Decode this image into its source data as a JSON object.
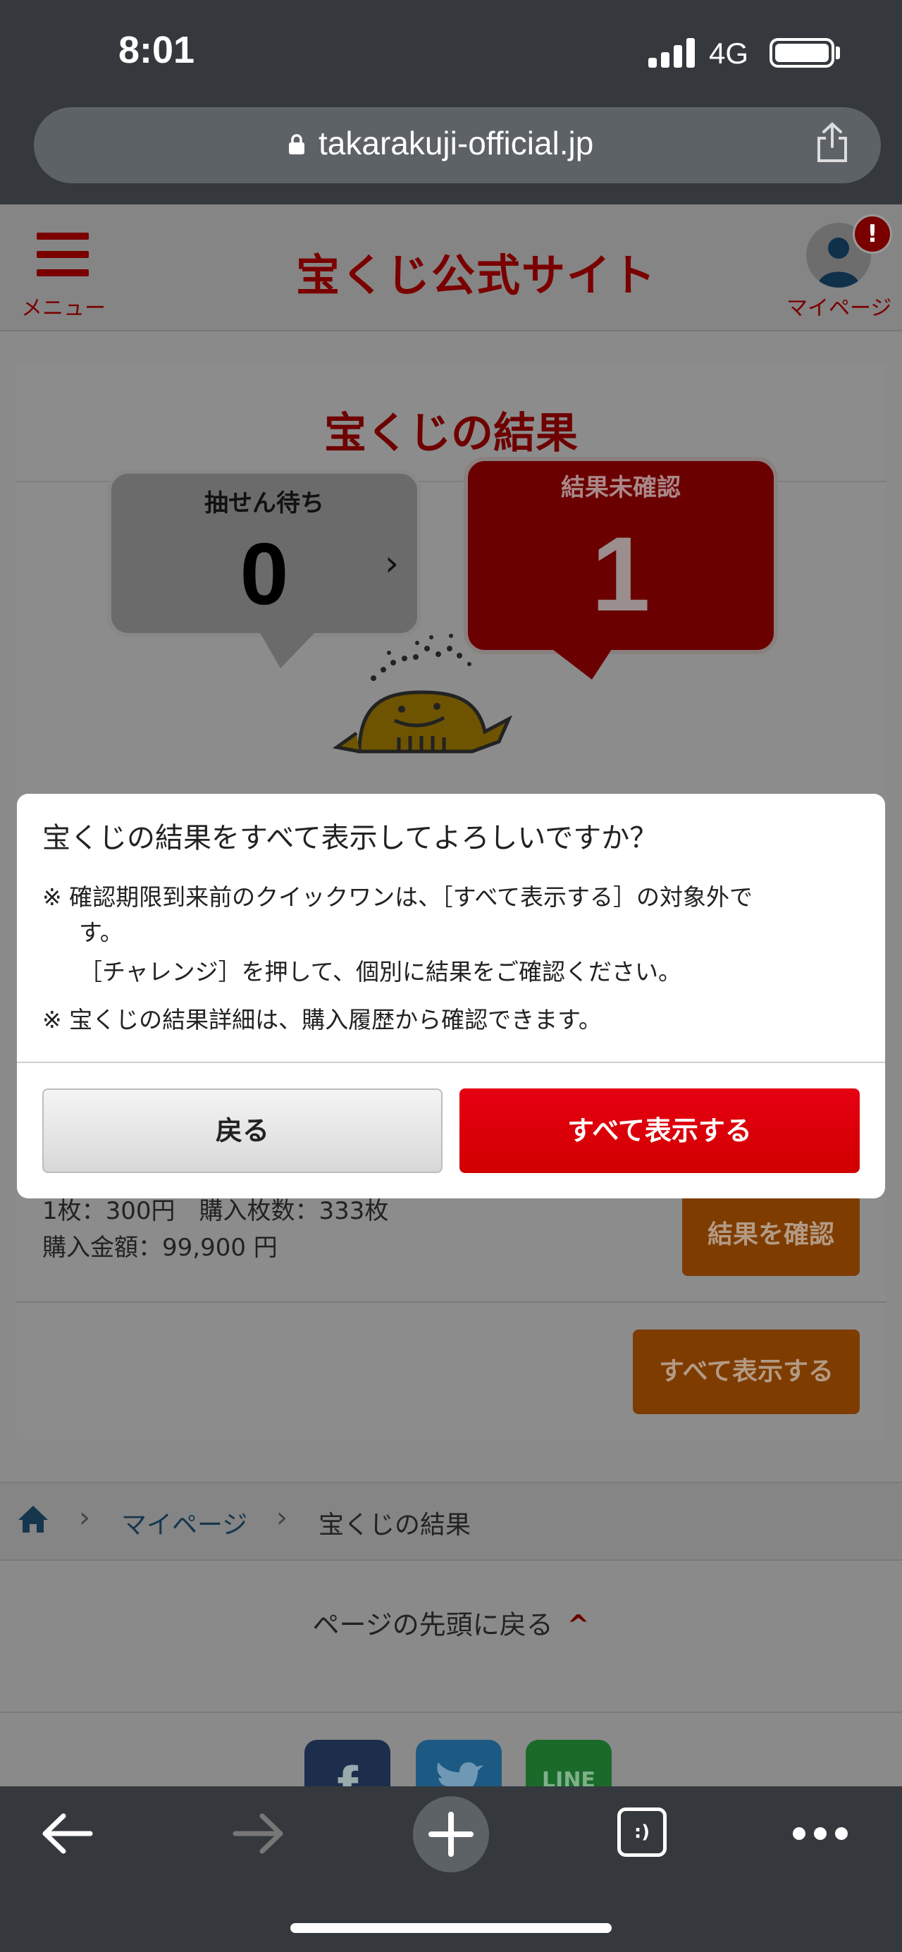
{
  "status_bar": {
    "time": "8:01",
    "network": "4G"
  },
  "browser": {
    "url": "takarakuji-official.jp"
  },
  "header": {
    "menu_label": "メニュー",
    "site_title": "宝くじ公式サイト",
    "mypage_label": "マイページ",
    "mypage_badge": "!"
  },
  "results": {
    "title": "宝くじの結果",
    "pending": {
      "label": "抽せん待ち",
      "count": "0",
      "arrow": "›"
    },
    "unconfirmed": {
      "label": "結果未確認",
      "count": "1"
    }
  },
  "purchase": {
    "line1": "1枚：300円　購入枚数：333枚",
    "line2": "購入金額：99,900 円",
    "confirm_button": "結果を確認",
    "show_all_button": "すべて表示する"
  },
  "modal": {
    "title": "宝くじの結果をすべて表示してよろしいですか？",
    "note1_line1": "※  確認期限到来前のクイックワンは、［すべて表示する］の対象外で",
    "note1_line2": "す。",
    "note1_line3": "［チャレンジ］を押して、個別に結果をご確認ください。",
    "note2": "※  宝くじの結果詳細は、購入履歴から確認できます。",
    "back_button": "戻る",
    "show_all_button": "すべて表示する"
  },
  "breadcrumb": {
    "sep": "›",
    "mypage": "マイページ",
    "current": "宝くじの結果"
  },
  "footer": {
    "page_top": "ページの先頭に戻る",
    "page_top_arrow": "^",
    "sns": {
      "facebook": "f",
      "line": "LINE"
    }
  },
  "toolbar": {
    "tabs_label": ":)"
  }
}
